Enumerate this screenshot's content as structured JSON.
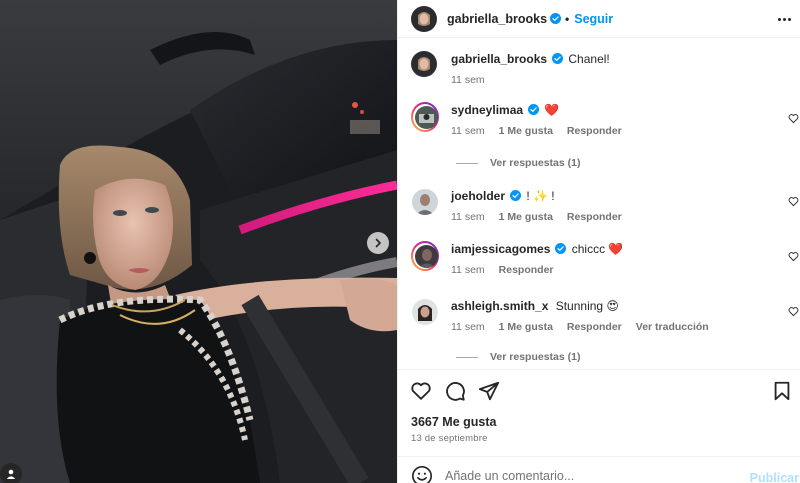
{
  "post": {
    "author": "gabriella_brooks",
    "follow_label": "Seguir",
    "separator": "•",
    "more_icon": "more-horizontal-icon",
    "caption": {
      "username": "gabriella_brooks",
      "text": "Chanel!",
      "time": "11 sem"
    }
  },
  "comments": [
    {
      "username": "sydneylimaa",
      "text": "❤️",
      "time": "11 sem",
      "likes": "1 Me gusta",
      "reply": "Responder",
      "verified": true,
      "story_ring": true,
      "replies_label": "Ver respuestas (1)"
    },
    {
      "username": "joeholder",
      "text": "! ✨ !",
      "time": "11 sem",
      "likes": "1 Me gusta",
      "reply": "Responder",
      "verified": true,
      "story_ring": false
    },
    {
      "username": "iamjessicagomes",
      "text": "chiccc ❤️",
      "time": "11 sem",
      "reply": "Responder",
      "verified": true,
      "story_ring": true
    },
    {
      "username": "ashleigh.smith_x",
      "text": "Stunning 😍",
      "time": "11 sem",
      "likes": "1 Me gusta",
      "reply": "Responder",
      "translate": "Ver traducción",
      "verified": false,
      "story_ring": false,
      "replies_label": "Ver respuestas (1)"
    }
  ],
  "actions": {
    "icons": [
      "heart-icon",
      "comment-icon",
      "share-icon",
      "bookmark-icon"
    ],
    "likes": "3667 Me gusta",
    "date": "13 de septiembre"
  },
  "composer": {
    "placeholder": "Añade un comentario...",
    "publish_label": "Publicar",
    "emoji_icon": "emoji-icon"
  },
  "colors": {
    "accent": "#0095f6",
    "verified": "#0095f6",
    "like_red": "#ed4956",
    "muted": "#737373",
    "publish_disabled": "#b2dffc"
  }
}
